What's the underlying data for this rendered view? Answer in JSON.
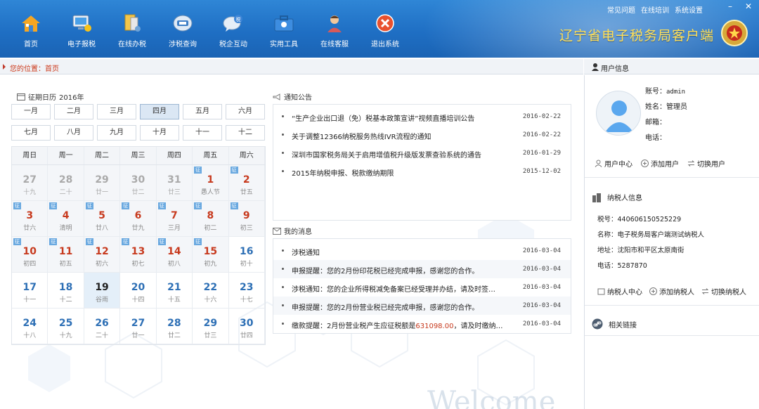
{
  "toolbar": [
    {
      "label": "首页",
      "icon": "home-icon"
    },
    {
      "label": "电子报税",
      "icon": "tax-report-icon"
    },
    {
      "label": "在线办税",
      "icon": "online-tax-icon"
    },
    {
      "label": "涉税查询",
      "icon": "tax-query-icon"
    },
    {
      "label": "税企互动",
      "icon": "chat-icon"
    },
    {
      "label": "实用工具",
      "icon": "toolbox-icon"
    },
    {
      "label": "在线客服",
      "icon": "customer-service-icon"
    },
    {
      "label": "退出系统",
      "icon": "exit-icon"
    }
  ],
  "toplinks": [
    "常见问题",
    "在线培训",
    "系统设置"
  ],
  "window_controls": {
    "minimize": "–",
    "close": "✕"
  },
  "brand": "辽宁省电子税务局客户端",
  "breadcrumb": {
    "label": "您的位置：",
    "current": "首页"
  },
  "calendar": {
    "title": "征期日历",
    "year": "2016年",
    "months": [
      "一月",
      "二月",
      "三月",
      "四月",
      "五月",
      "六月",
      "七月",
      "八月",
      "九月",
      "十月",
      "十一",
      "十二"
    ],
    "active_month_index": 3,
    "weekdays": [
      "周日",
      "周一",
      "周二",
      "周三",
      "周四",
      "周五",
      "周六"
    ],
    "tag": "征",
    "weeks": [
      [
        {
          "d": "27",
          "l": "十九",
          "s": "other"
        },
        {
          "d": "28",
          "l": "二十",
          "s": "other"
        },
        {
          "d": "29",
          "l": "廿一",
          "s": "other"
        },
        {
          "d": "30",
          "l": "廿二",
          "s": "other"
        },
        {
          "d": "31",
          "l": "廿三",
          "s": "other"
        },
        {
          "d": "1",
          "l": "愚人节",
          "s": "red",
          "tag": true
        },
        {
          "d": "2",
          "l": "廿五",
          "s": "red",
          "tag": true
        }
      ],
      [
        {
          "d": "3",
          "l": "廿六",
          "s": "red",
          "tag": true
        },
        {
          "d": "4",
          "l": "清明",
          "s": "red",
          "tag": true
        },
        {
          "d": "5",
          "l": "廿八",
          "s": "red",
          "tag": true
        },
        {
          "d": "6",
          "l": "廿九",
          "s": "red",
          "tag": true
        },
        {
          "d": "7",
          "l": "三月",
          "s": "red",
          "tag": true
        },
        {
          "d": "8",
          "l": "初二",
          "s": "red",
          "tag": true
        },
        {
          "d": "9",
          "l": "初三",
          "s": "red",
          "tag": true
        }
      ],
      [
        {
          "d": "10",
          "l": "初四",
          "s": "red",
          "tag": true
        },
        {
          "d": "11",
          "l": "初五",
          "s": "red",
          "tag": true
        },
        {
          "d": "12",
          "l": "初六",
          "s": "red",
          "tag": true
        },
        {
          "d": "13",
          "l": "初七",
          "s": "red",
          "tag": true
        },
        {
          "d": "14",
          "l": "初八",
          "s": "red",
          "tag": true
        },
        {
          "d": "15",
          "l": "初九",
          "s": "red",
          "tag": true
        },
        {
          "d": "16",
          "l": "初十",
          "s": "blue"
        }
      ],
      [
        {
          "d": "17",
          "l": "十一",
          "s": "blue"
        },
        {
          "d": "18",
          "l": "十二",
          "s": "blue"
        },
        {
          "d": "19",
          "l": "谷雨",
          "s": "today"
        },
        {
          "d": "20",
          "l": "十四",
          "s": "blue"
        },
        {
          "d": "21",
          "l": "十五",
          "s": "blue"
        },
        {
          "d": "22",
          "l": "十六",
          "s": "blue"
        },
        {
          "d": "23",
          "l": "十七",
          "s": "blue"
        }
      ],
      [
        {
          "d": "24",
          "l": "十八",
          "s": "blue"
        },
        {
          "d": "25",
          "l": "十九",
          "s": "blue"
        },
        {
          "d": "26",
          "l": "二十",
          "s": "blue"
        },
        {
          "d": "27",
          "l": "廿一",
          "s": "blue"
        },
        {
          "d": "28",
          "l": "廿二",
          "s": "blue"
        },
        {
          "d": "29",
          "l": "廿三",
          "s": "blue"
        },
        {
          "d": "30",
          "l": "廿四",
          "s": "blue"
        }
      ]
    ]
  },
  "notices": {
    "title": "通知公告",
    "items": [
      {
        "text": "“生产企业出口退（免）税基本政策宣讲”视频直播培训公告",
        "date": "2016-02-22"
      },
      {
        "text": "关于调整12366纳税服务热线IVR流程的通知",
        "date": "2016-02-22"
      },
      {
        "text": "深圳市国家税务局关于启用增值税升级版发票查验系统的通告",
        "date": "2016-01-29"
      },
      {
        "text": "2015年纳税申报、税款缴纳期限",
        "date": "2015-12-02"
      }
    ]
  },
  "messages": {
    "title": "我的消息",
    "items": [
      {
        "text": "涉税通知",
        "date": "2016-03-04"
      },
      {
        "text": "申报提醒：您的2月份印花税已经完成申报，感谢您的合作。",
        "date": "2016-03-04"
      },
      {
        "text": "涉税通知：您的企业所得税减免备案已经受理并办结，请及时签…",
        "date": "2016-03-04"
      },
      {
        "text": "申报提醒：您的2月份营业税已经完成申报，感谢您的合作。",
        "date": "2016-03-04"
      },
      {
        "text_pre": "缴款提醒：2月份营业税产生应征税额是",
        "amount": "631098.00",
        "text_post": "，请及时缴纳…",
        "date": "2016-03-04"
      }
    ]
  },
  "user": {
    "header": "用户信息",
    "account_label": "账号：",
    "account": "admin",
    "name_label": "姓名：",
    "name": "管理员",
    "email_label": "邮箱：",
    "email": "",
    "phone_label": "电话：",
    "phone": "",
    "actions": [
      "用户中心",
      "添加用户",
      "切换用户"
    ]
  },
  "taxpayer": {
    "header": "纳税人信息",
    "id_label": "税号：",
    "id": "440606150525229",
    "name_label": "名称：",
    "name": "电子税务局客户端测试纳税人",
    "address_label": "地址：",
    "address": "沈阳市和平区太原南街",
    "phone_label": "电话：",
    "phone": "5287870",
    "actions": [
      "纳税人中心",
      "添加纳税人",
      "切换纳税人"
    ]
  },
  "links": {
    "header": "相关链接"
  },
  "watermark": "Welcome",
  "colors": {
    "topbar": "#1f6fc4",
    "accent_red": "#c73a1e",
    "accent_blue": "#2d6fb5",
    "brand_gold": "#ffe05a"
  }
}
